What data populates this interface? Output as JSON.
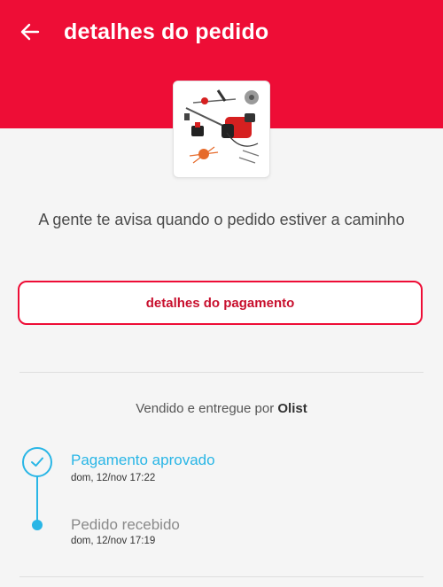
{
  "header": {
    "title": "detalhes do pedido",
    "back_icon": "arrow-left-icon",
    "color": "#ee0d36"
  },
  "product": {
    "image_icon": "brush-cutter-product-image"
  },
  "notice": "A gente te avisa quando o pedido estiver a caminho",
  "payment_button": {
    "label": "detalhes do pagamento"
  },
  "seller": {
    "prefix": "Vendido e entregue por",
    "name": "Olist"
  },
  "timeline": {
    "accent_color": "#29b6e6",
    "steps": [
      {
        "title": "Pagamento aprovado",
        "time": "dom, 12/nov 17:22",
        "icon": "check-icon",
        "state": "active"
      },
      {
        "title": "Pedido recebido",
        "time": "dom, 12/nov 17:19",
        "icon": "dot-icon",
        "state": "done"
      }
    ]
  }
}
